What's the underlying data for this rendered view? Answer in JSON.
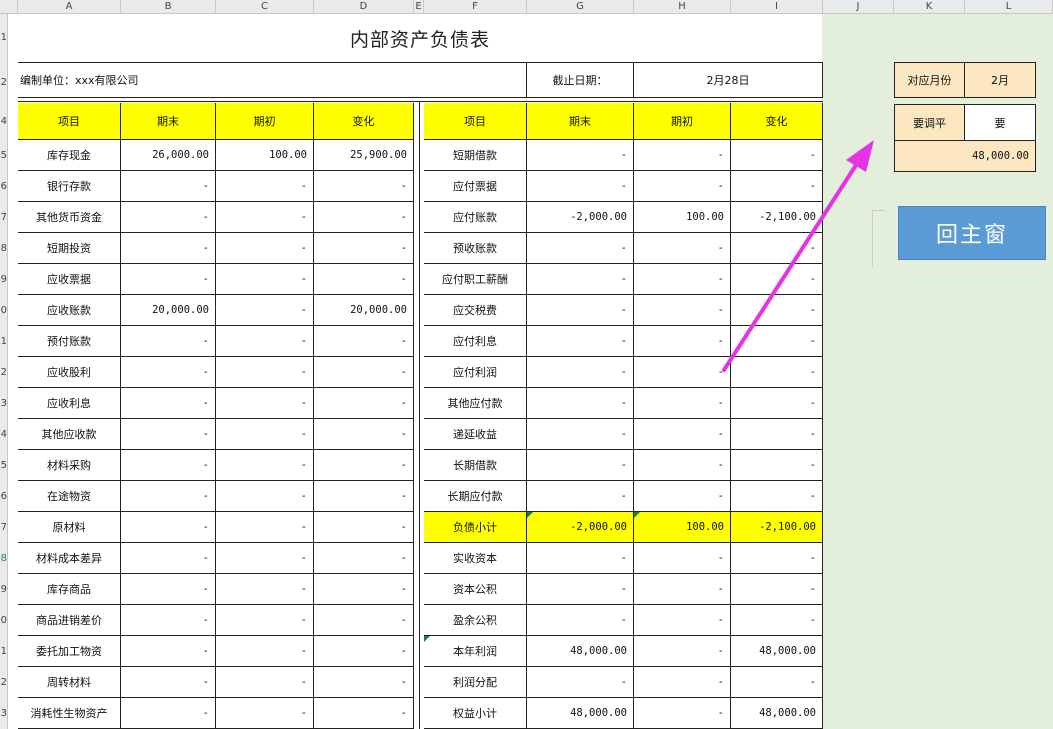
{
  "columns": [
    "A",
    "B",
    "C",
    "D",
    "E",
    "F",
    "G",
    "H",
    "I",
    "J",
    "K",
    "L"
  ],
  "rows": [
    "1",
    "2",
    "4",
    "5",
    "6",
    "7",
    "8",
    "9",
    "0",
    "1",
    "2",
    "3",
    "4",
    "5",
    "6",
    "7",
    "8",
    "9",
    "0",
    "1",
    "2",
    "3"
  ],
  "title": "内部资产负债表",
  "unit_label": "编制单位：xxx有限公司",
  "date_label": "截止日期：",
  "date_value": "2月28日",
  "headers": {
    "left": [
      "项目",
      "期末",
      "期初",
      "变化"
    ],
    "right": [
      "项目",
      "期末",
      "期初",
      "变化"
    ]
  },
  "assets": [
    {
      "name": "库存现金",
      "end": "26,000.00",
      "start": "100.00",
      "change": "25,900.00"
    },
    {
      "name": "银行存款",
      "end": "-",
      "start": "-",
      "change": "-"
    },
    {
      "name": "其他货币资金",
      "end": "-",
      "start": "-",
      "change": "-"
    },
    {
      "name": "短期投资",
      "end": "-",
      "start": "-",
      "change": "-"
    },
    {
      "name": "应收票据",
      "end": "-",
      "start": "-",
      "change": "-"
    },
    {
      "name": "应收账款",
      "end": "20,000.00",
      "start": "-",
      "change": "20,000.00"
    },
    {
      "name": "预付账款",
      "end": "-",
      "start": "-",
      "change": "-"
    },
    {
      "name": "应收股利",
      "end": "-",
      "start": "-",
      "change": "-"
    },
    {
      "name": "应收利息",
      "end": "-",
      "start": "-",
      "change": "-"
    },
    {
      "name": "其他应收款",
      "end": "-",
      "start": "-",
      "change": "-"
    },
    {
      "name": "材料采购",
      "end": "-",
      "start": "-",
      "change": "-"
    },
    {
      "name": "在途物资",
      "end": "-",
      "start": "-",
      "change": "-"
    },
    {
      "name": "原材料",
      "end": "-",
      "start": "-",
      "change": "-"
    },
    {
      "name": "材料成本差异",
      "end": "-",
      "start": "-",
      "change": "-"
    },
    {
      "name": "库存商品",
      "end": "-",
      "start": "-",
      "change": "-"
    },
    {
      "name": "商品进销差价",
      "end": "-",
      "start": "-",
      "change": "-"
    },
    {
      "name": "委托加工物资",
      "end": "-",
      "start": "-",
      "change": "-"
    },
    {
      "name": "周转材料",
      "end": "-",
      "start": "-",
      "change": "-"
    },
    {
      "name": "消耗性生物资产",
      "end": "-",
      "start": "-",
      "change": "-"
    }
  ],
  "liabilities": [
    {
      "name": "短期借款",
      "end": "-",
      "start": "-",
      "change": "-"
    },
    {
      "name": "应付票据",
      "end": "-",
      "start": "-",
      "change": "-"
    },
    {
      "name": "应付账款",
      "end": "-2,000.00",
      "start": "100.00",
      "change": "-2,100.00"
    },
    {
      "name": "预收账款",
      "end": "-",
      "start": "-",
      "change": "-"
    },
    {
      "name": "应付职工薪酬",
      "end": "-",
      "start": "-",
      "change": "-"
    },
    {
      "name": "应交税费",
      "end": "-",
      "start": "-",
      "change": "-"
    },
    {
      "name": "应付利息",
      "end": "-",
      "start": "-",
      "change": "-"
    },
    {
      "name": "应付利润",
      "end": "-",
      "start": "-",
      "change": "-"
    },
    {
      "name": "其他应付款",
      "end": "-",
      "start": "-",
      "change": "-"
    },
    {
      "name": "递延收益",
      "end": "-",
      "start": "-",
      "change": "-"
    },
    {
      "name": "长期借款",
      "end": "-",
      "start": "-",
      "change": "-"
    },
    {
      "name": "长期应付款",
      "end": "-",
      "start": "-",
      "change": "-"
    },
    {
      "name": "负债小计",
      "end": "-2,000.00",
      "start": "100.00",
      "change": "-2,100.00"
    },
    {
      "name": "实收资本",
      "end": "-",
      "start": "-",
      "change": "-"
    },
    {
      "name": "资本公积",
      "end": "-",
      "start": "-",
      "change": "-"
    },
    {
      "name": "盈余公积",
      "end": "-",
      "start": "-",
      "change": "-"
    },
    {
      "name": "本年利润",
      "end": "48,000.00",
      "start": "-",
      "change": "48,000.00"
    },
    {
      "name": "利润分配",
      "end": "-",
      "start": "-",
      "change": "-"
    },
    {
      "name": "权益小计",
      "end": "48,000.00",
      "start": "-",
      "change": "48,000.00"
    }
  ],
  "side": {
    "month_label": "对应月份",
    "month_value": "2月",
    "adjust_label": "要调平",
    "adjust_value": "要",
    "amount": "48,000.00",
    "main_button": "回主窗"
  },
  "colors": {
    "highlight": "#ffff00",
    "panel": "#e3efda",
    "button": "#5b9bd5",
    "arrow": "#e532e5"
  }
}
